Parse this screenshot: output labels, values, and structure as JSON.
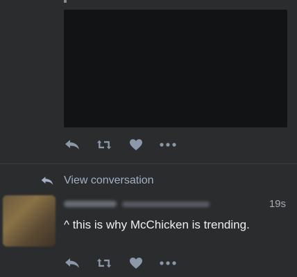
{
  "previous_tweet": {
    "actions": {
      "reply_icon": "reply-icon",
      "retweet_icon": "retweet-icon",
      "like_icon": "heart-icon",
      "more_icon": "more-dots-icon"
    }
  },
  "conversation": {
    "label": "View conversation",
    "icon": "reply-icon"
  },
  "tweet": {
    "time": "19s",
    "text": "^ this is why McChicken is trending.",
    "actions": {
      "reply_icon": "reply-icon",
      "retweet_icon": "retweet-icon",
      "like_icon": "heart-icon",
      "more_icon": "more-dots-icon"
    }
  },
  "colors": {
    "background": "#2b2c2e",
    "icon": "#8b98aa",
    "link": "#a3b1c6",
    "text": "#f0f0f0"
  }
}
